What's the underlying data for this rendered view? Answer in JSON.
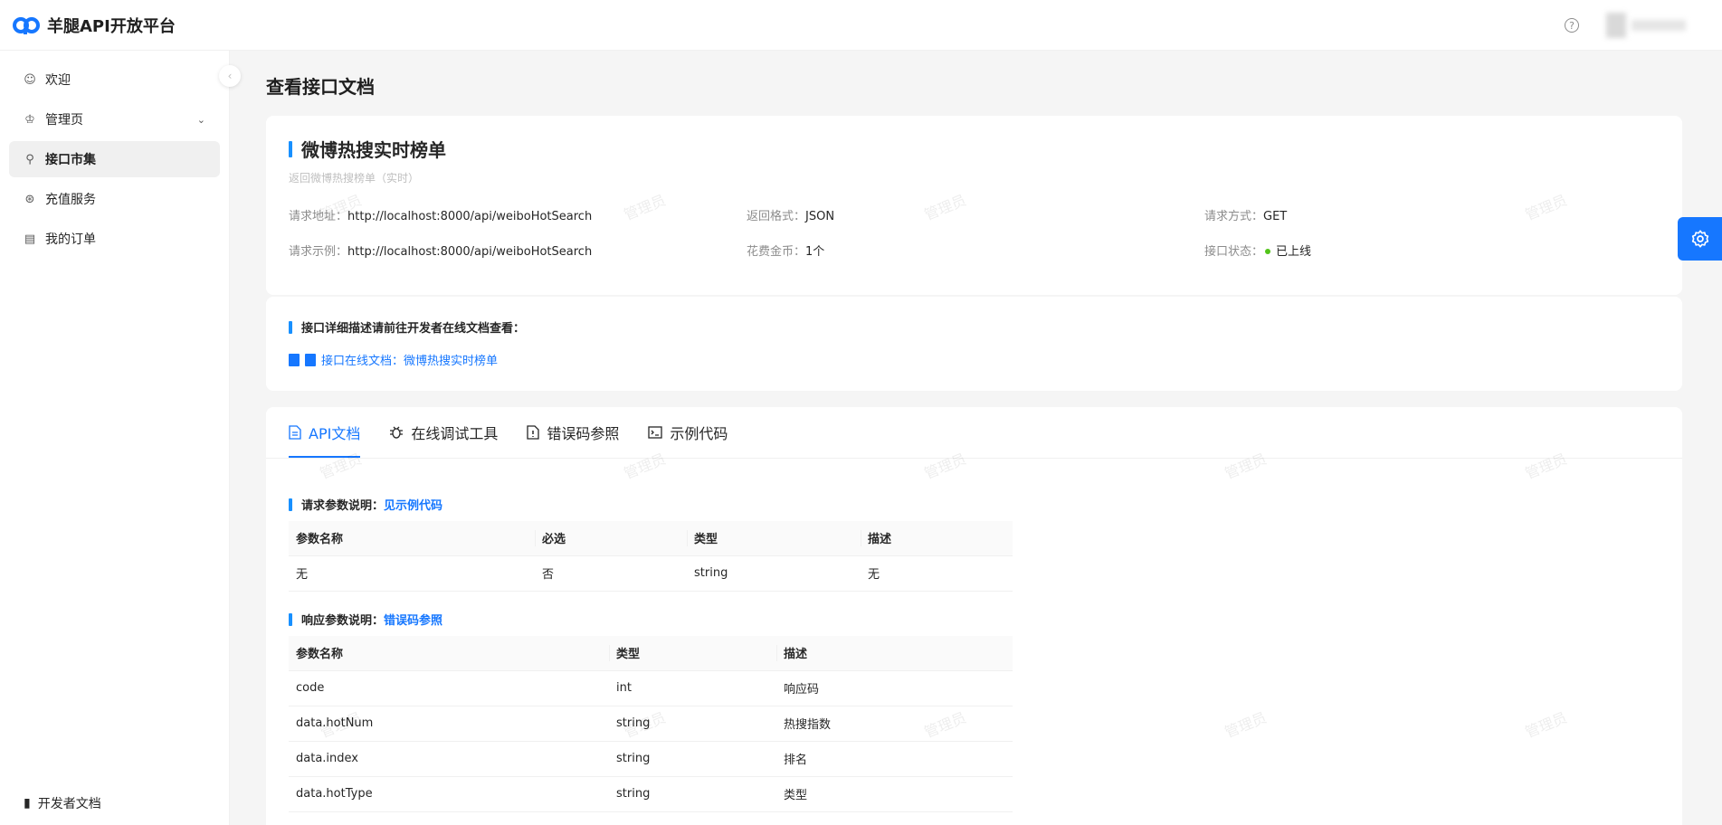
{
  "app": {
    "title": "羊腿API开放平台"
  },
  "header": {
    "help": "?"
  },
  "sidebar": {
    "items": [
      {
        "label": "欢迎",
        "icon": "smile-icon"
      },
      {
        "label": "管理页",
        "icon": "crown-icon"
      },
      {
        "label": "接口市集",
        "icon": "link-icon"
      },
      {
        "label": "充值服务",
        "icon": "coin-icon"
      },
      {
        "label": "我的订单",
        "icon": "list-icon"
      }
    ],
    "footer": "开发者文档"
  },
  "page": {
    "title": "查看接口文档"
  },
  "api": {
    "name": "微博热搜实时榜单",
    "desc": "返回微博热搜榜单（实时）",
    "url_label": "请求地址：",
    "url": "http://localhost:8000/api/weiboHotSearch",
    "format_label": "返回格式：",
    "format": "JSON",
    "method_label": "请求方式：",
    "method": "GET",
    "example_label": "请求示例：",
    "example": "http://localhost:8000/api/weiboHotSearch",
    "cost_label": "花费金币：",
    "cost": "1个",
    "status_label": "接口状态：",
    "status": "已上线",
    "status_color": "#52c41a"
  },
  "docs": {
    "title": "接口详细描述请前往开发者在线文档查看：",
    "link": "接口在线文档：微博热搜实时榜单"
  },
  "tabs": [
    {
      "label": "API文档",
      "icon": "file-icon"
    },
    {
      "label": "在线调试工具",
      "icon": "bug-icon"
    },
    {
      "label": "错误码参照",
      "icon": "file-exclamation-icon"
    },
    {
      "label": "示例代码",
      "icon": "code-icon"
    }
  ],
  "request_params": {
    "title": "请求参数说明：",
    "link": "见示例代码",
    "headers": [
      "参数名称",
      "必选",
      "类型",
      "描述"
    ],
    "rows": [
      [
        "无",
        "否",
        "string",
        "无"
      ]
    ]
  },
  "response_params": {
    "title": "响应参数说明：",
    "link": "错误码参照",
    "headers": [
      "参数名称",
      "类型",
      "描述"
    ],
    "rows": [
      [
        "code",
        "int",
        "响应码"
      ],
      [
        "data.hotNum",
        "string",
        "热搜指数"
      ],
      [
        "data.index",
        "string",
        "排名"
      ],
      [
        "data.hotType",
        "string",
        "类型"
      ]
    ]
  },
  "watermark": "管理员",
  "colors": {
    "accent": "#1677ff",
    "bar": "#1890ff"
  }
}
